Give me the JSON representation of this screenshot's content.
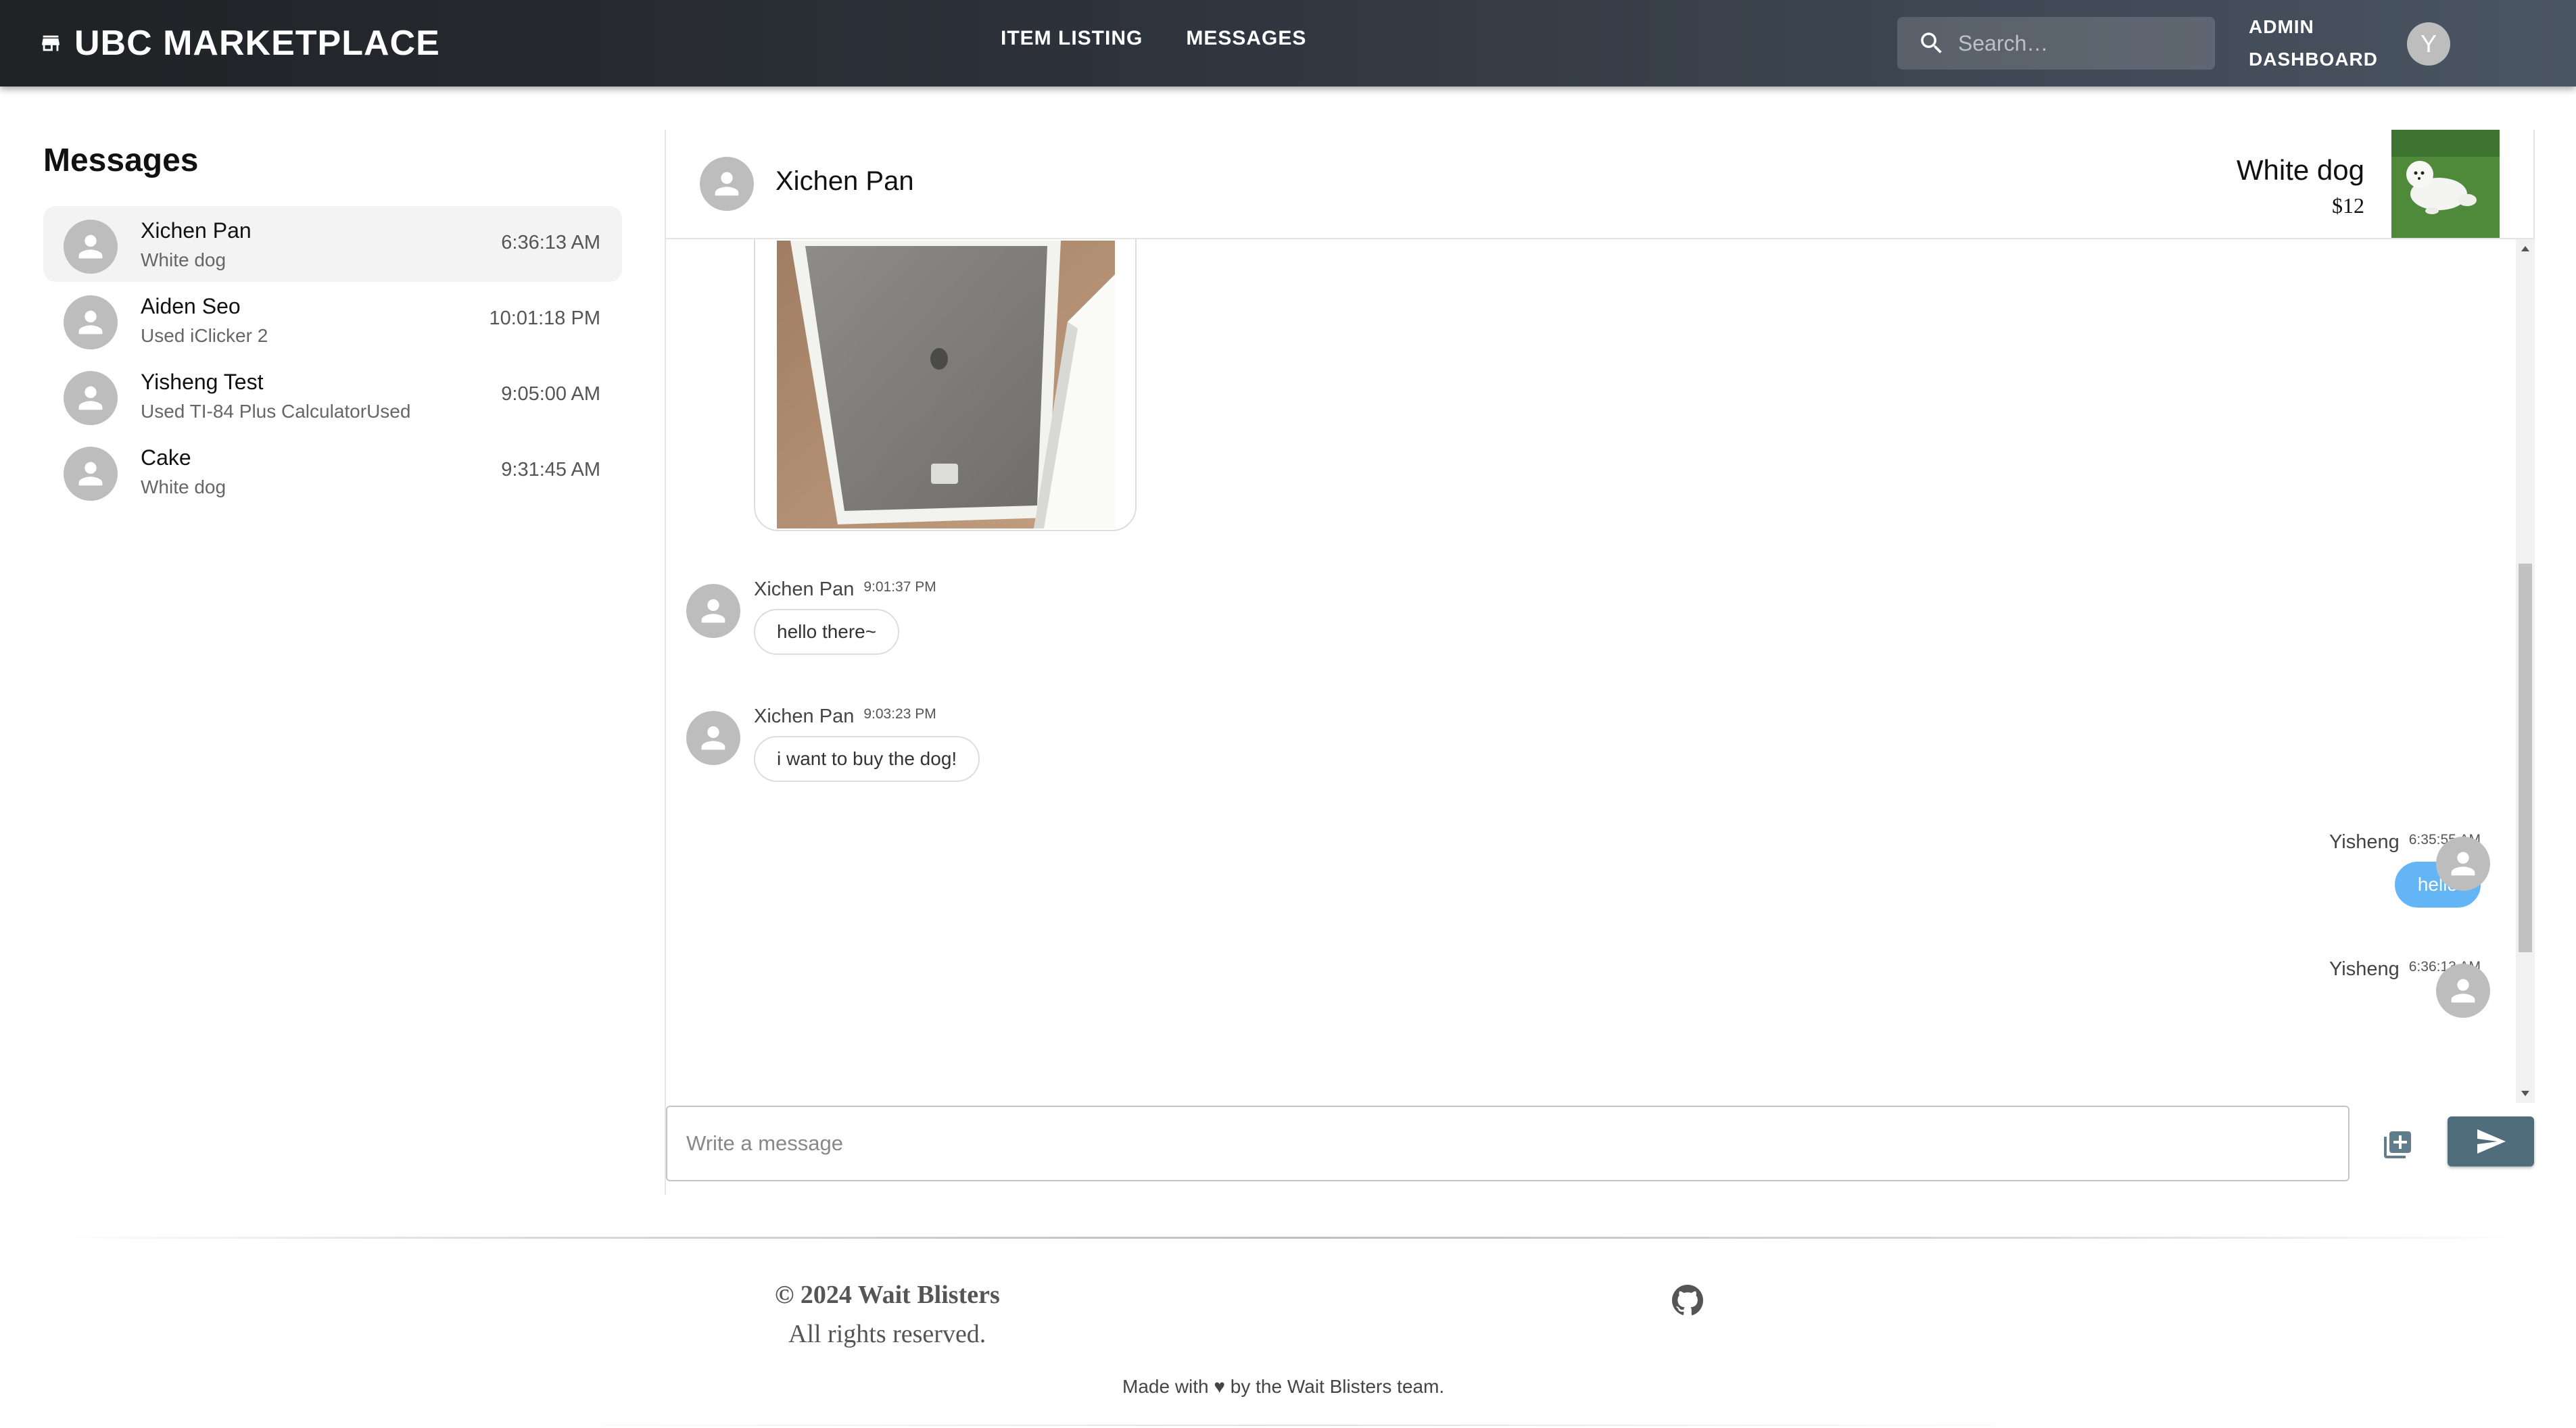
{
  "header": {
    "brand": "UBC MARKETPLACE",
    "brand_icon": "storefront-icon",
    "nav": [
      "ITEM LISTING",
      "MESSAGES"
    ],
    "search": {
      "placeholder": "Search…",
      "icon": "search-icon"
    },
    "admin_line1": "ADMIN",
    "admin_line2": "DASHBOARD",
    "user_initial": "Y"
  },
  "sidebar": {
    "title": "Messages",
    "conversations": [
      {
        "name": "Xichen Pan",
        "item": "White dog",
        "time": "6:36:13 AM",
        "active": true
      },
      {
        "name": "Aiden Seo",
        "item": "Used iClicker 2",
        "time": "10:01:18 PM",
        "active": false
      },
      {
        "name": "Yisheng Test",
        "item": "Used TI-84 Plus CalculatorUsed",
        "time": "9:05:00 AM",
        "active": false
      },
      {
        "name": "Cake",
        "item": "White dog",
        "time": "9:31:45 AM",
        "active": false
      }
    ]
  },
  "chat": {
    "peer_name": "Xichen Pan",
    "item_title": "White dog",
    "item_price": "$12",
    "messages": [
      {
        "sender": "Xichen Pan",
        "time": "9:01:37 PM",
        "text": "hello there~",
        "mine": false
      },
      {
        "sender": "Xichen Pan",
        "time": "9:03:23 PM",
        "text": "i want to buy the dog!",
        "mine": false
      },
      {
        "sender": "Yisheng",
        "time": "6:35:55 AM",
        "text": "hello",
        "mine": true
      },
      {
        "sender": "Yisheng",
        "time": "6:36:13 AM",
        "text": "",
        "mine": true
      }
    ],
    "composer_placeholder": "Write a message",
    "accent_color": "#64b5f6"
  },
  "footer": {
    "copyright": "© 2024 Wait Blisters",
    "rights": "All rights reserved.",
    "made_with": "Made with ♥ by the Wait Blisters team."
  }
}
